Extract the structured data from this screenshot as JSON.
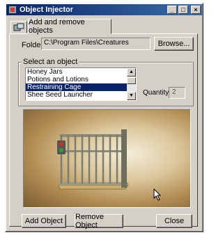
{
  "window": {
    "title": "Object Injector",
    "controls": [
      "_",
      "□",
      "×"
    ]
  },
  "tabs": [
    {
      "label": "",
      "icon": "objects-icon"
    },
    {
      "label": "Add and remove objects",
      "active": true
    }
  ],
  "folder": {
    "label": "Folder",
    "value": "C:\\Program Files\\Creatures",
    "browse_label": "Browse..."
  },
  "select_group": {
    "legend": "Select an object",
    "items": [
      {
        "label": "Honey Jars",
        "selected": false
      },
      {
        "label": "Potions and Lotions",
        "selected": false
      },
      {
        "label": "Restraining Cage",
        "selected": true
      },
      {
        "label": "Shee Seed Launcher",
        "selected": false
      }
    ],
    "quantity_label": "Quantity:",
    "quantity_value": "2"
  },
  "preview": {
    "object_name": "cage-preview",
    "colors": {
      "bars": "#7d7d6d",
      "base": "#c9ae6e",
      "light_red": "#d22b2b",
      "light_green": "#3a9a3a"
    }
  },
  "buttons": {
    "add": "Add Object",
    "remove": "Remove Object",
    "close": "Close"
  }
}
